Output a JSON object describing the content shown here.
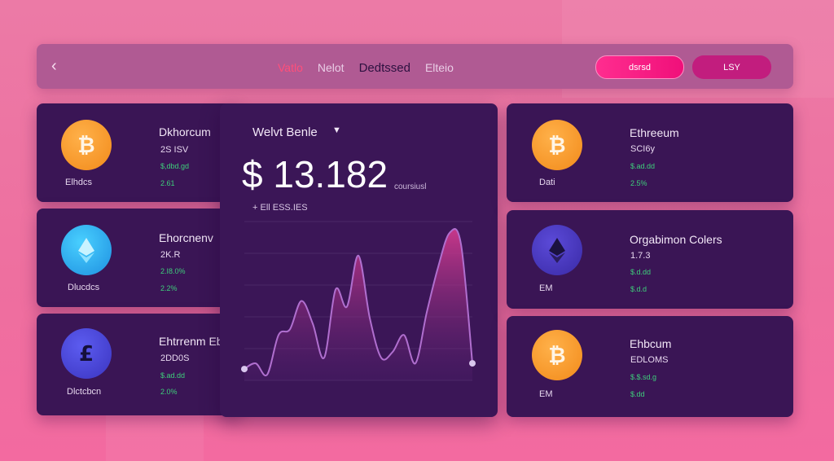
{
  "colors": {
    "background": "#ee75a3",
    "card": "#3a1555",
    "accent": "#ff2d8f",
    "positive": "#3ecf7b"
  },
  "topbar": {
    "back_icon": "chevron-left-icon",
    "nav": [
      "Vatlo",
      "Nelot",
      "Dedtssed",
      "Elteio"
    ],
    "primary_button": "dsrsd",
    "secondary_button": "LSY"
  },
  "left_cards": [
    {
      "icon": "bitcoin-icon",
      "name": "Dkhorcum",
      "value": "2S ISV",
      "change": "$,dbd.gd",
      "change2": "2.61",
      "label": "Elhdcs"
    },
    {
      "icon": "ethereum-icon",
      "name": "Ehorcnenv",
      "value": "2K.R",
      "change": "2.I8.0%",
      "change2": "2.2%",
      "label": "Dlucdcs"
    },
    {
      "icon": "euro-coin-icon",
      "name": "Ehtrrenm Eb",
      "value": "2DD0S",
      "change": "$.ad.dd",
      "change2": "2.0%",
      "label": "Dlctcbcn"
    }
  ],
  "right_cards": [
    {
      "icon": "bitcoin-icon",
      "name": "Ethreeum",
      "value": "SCI6y",
      "change": "$.ad.dd",
      "change2": "2.5%",
      "label": "Dati"
    },
    {
      "icon": "ethereum-icon",
      "name": "Orgabimon Colers",
      "value": "1.7.3",
      "change": "$.d.dd",
      "change2": "$.d.d",
      "label": "EM"
    },
    {
      "icon": "bitcoin-icon",
      "name": "Ehbcum",
      "value": "EDLOMS",
      "change": "$.$.sd.g",
      "change2": "$.dd",
      "label": "EM"
    }
  ],
  "wallet": {
    "title": "Welvt Benle",
    "caret_icon": "caret-down-icon",
    "balance": "$ 13.182",
    "balance_sub": "coursiusl",
    "change_text": "+ Ell ESS.IES"
  },
  "chart_data": {
    "type": "area",
    "x": [
      0,
      1,
      2,
      3,
      4,
      5,
      6,
      7,
      8,
      9,
      10,
      11,
      12,
      13,
      14,
      15,
      16,
      17,
      18,
      19,
      20
    ],
    "values": [
      2,
      3,
      1,
      8,
      9,
      14,
      10,
      4,
      16,
      13,
      22,
      11,
      4,
      5,
      8,
      3,
      12,
      20,
      26,
      24,
      3
    ],
    "ylim": [
      0,
      28
    ],
    "grid": true
  }
}
